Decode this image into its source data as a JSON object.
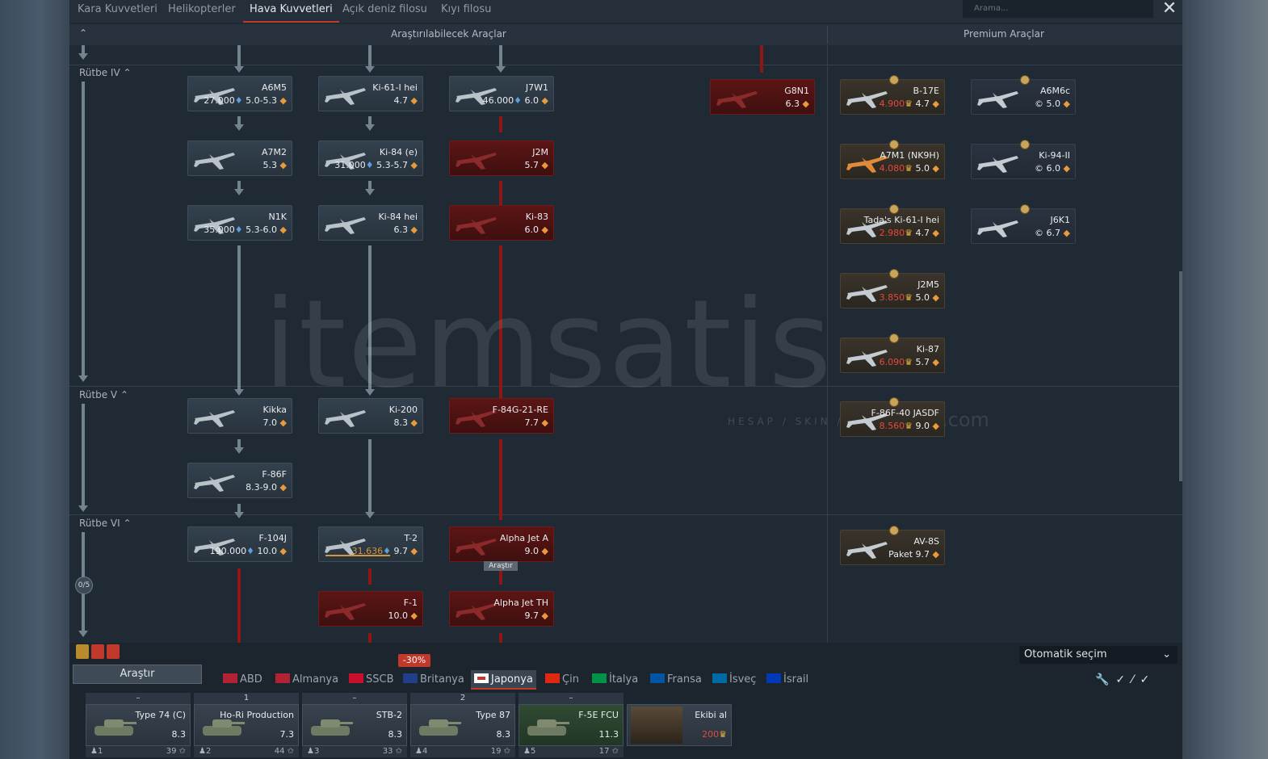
{
  "tabs": [
    "Kara Kuvvetleri",
    "Helikopterler",
    "Hava Kuvvetleri",
    "Açık deniz filosu",
    "Kıyı filosu"
  ],
  "search_placeholder": "Arama...",
  "header": {
    "research": "Araştırılabilecek Araçlar",
    "premium": "Premium Araçlar"
  },
  "ranks": {
    "r4": "Rütbe IV",
    "r5": "Rütbe V",
    "r6": "Rütbe VI"
  },
  "progress_counter": "0/5",
  "cards": [
    {
      "name": "A6M5",
      "rp": "27.000",
      "br": "5.0-5.3"
    },
    {
      "name": "Ki-61-I hei",
      "rp": "",
      "br": "4.7"
    },
    {
      "name": "J7W1",
      "rp": "46.000",
      "br": "6.0"
    },
    {
      "name": "G8N1",
      "rp": "",
      "br": "6.3"
    },
    {
      "name": "A7M2",
      "rp": "",
      "br": "5.3"
    },
    {
      "name": "Ki-84 (e)",
      "rp": "31.000",
      "br": "5.3-5.7"
    },
    {
      "name": "J2M",
      "rp": "",
      "br": "5.7"
    },
    {
      "name": "N1K",
      "rp": "35.000",
      "br": "5.3-6.0"
    },
    {
      "name": "Ki-84 hei",
      "rp": "",
      "br": "6.3"
    },
    {
      "name": "Ki-83",
      "rp": "",
      "br": "6.0"
    },
    {
      "name": "Kikka",
      "rp": "",
      "br": "7.0"
    },
    {
      "name": "Ki-200",
      "rp": "",
      "br": "8.3"
    },
    {
      "name": "F-84G-21-RE",
      "rp": "",
      "br": "7.7"
    },
    {
      "name": "F-86F",
      "rp": "",
      "br": "8.3-9.0"
    },
    {
      "name": "F-104J",
      "rp": "190.000",
      "br": "10.0"
    },
    {
      "name": "T-2",
      "rp": "31.636",
      "br": "9.7"
    },
    {
      "name": "Alpha Jet A",
      "rp": "",
      "br": "9.0"
    },
    {
      "name": "F-1",
      "rp": "",
      "br": "10.0"
    },
    {
      "name": "Alpha Jet TH",
      "rp": "",
      "br": "9.7"
    }
  ],
  "premium": [
    {
      "name": "B-17E",
      "gold": "4.900",
      "br": "4.7"
    },
    {
      "name": "A6M6c",
      "gold": "",
      "br": "5.0"
    },
    {
      "name": "A7M1 (NK9H)",
      "gold": "4.080",
      "br": "5.0"
    },
    {
      "name": "Ki-94-II",
      "gold": "",
      "br": "6.0"
    },
    {
      "name": "Tada's Ki-61-I hei",
      "gold": "2.980",
      "br": "4.7"
    },
    {
      "name": "J6K1",
      "gold": "",
      "br": "6.7"
    },
    {
      "name": "J2M5",
      "gold": "3.850",
      "br": "5.0"
    },
    {
      "name": "Ki-87",
      "gold": "6.090",
      "br": "5.7"
    },
    {
      "name": "F-86F-40 JASDF",
      "gold": "8.560",
      "br": "9.0"
    },
    {
      "name": "AV-8S",
      "gold": "Paket",
      "br": "9.7"
    }
  ],
  "research_button": "Araştır",
  "research_bar_label": "Araştır",
  "discount": "-30%",
  "auto_select": "Otomatik seçim",
  "nations": [
    "ABD",
    "Almanya",
    "SSCB",
    "Britanya",
    "Japonya",
    "Çin",
    "İtalya",
    "Fransa",
    "İsveç",
    "İsrail"
  ],
  "crew": [
    {
      "head": "–",
      "name": "Type 74 (C)",
      "br": "8.3",
      "num": "1",
      "lvl": "39"
    },
    {
      "head": "1",
      "name": "Ho-Ri Production",
      "br": "7.3",
      "num": "2",
      "lvl": "44"
    },
    {
      "head": "–",
      "name": "STB-2",
      "br": "8.3",
      "num": "3",
      "lvl": "33"
    },
    {
      "head": "2",
      "name": "Type 87",
      "br": "8.3",
      "num": "4",
      "lvl": "19"
    },
    {
      "head": "–",
      "name": "F-5E FCU",
      "br": "11.3",
      "num": "5",
      "lvl": "17"
    }
  ],
  "buy_crew": {
    "label": "Ekibi al",
    "price": "200"
  },
  "watermark": {
    "main": "itemsatis",
    "sub": "HESAP / SKIN / İTEM",
    "com": ".com"
  },
  "colors": {
    "accent": "#c0392b",
    "locked": "#8e1616",
    "rp": "#5da0e0",
    "gold": "#e8b43c"
  }
}
